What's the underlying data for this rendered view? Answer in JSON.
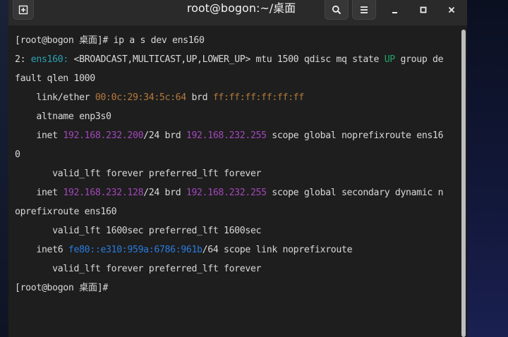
{
  "window": {
    "title": "root@bogon:~/桌面"
  },
  "icons": {
    "new_tab": "new-tab-icon",
    "search": "search-icon",
    "menu": "hamburger-menu-icon",
    "minimize": "minimize-icon",
    "maximize": "maximize-icon",
    "close": "close-icon"
  },
  "colors": {
    "cyan": "#2aa1b3",
    "green": "#26a269",
    "orange": "#b5793c",
    "purple": "#a347ba",
    "blue": "#2a7bde",
    "foreground": "#d8d8d8",
    "background": "#1e1e1e"
  },
  "terminal": {
    "lines": [
      [
        {
          "t": "[root@bogon 桌面]# ip a s dev ens160"
        }
      ],
      [
        {
          "t": "2: "
        },
        {
          "t": "ens160:",
          "c": "cyan"
        },
        {
          "t": " <BROADCAST,MULTICAST,UP,LOWER_UP> mtu 1500 qdisc mq state "
        },
        {
          "t": "UP",
          "c": "green"
        },
        {
          "t": " group de"
        }
      ],
      [
        {
          "t": "fault qlen 1000"
        }
      ],
      [
        {
          "t": "    link/ether "
        },
        {
          "t": "00:0c:29:34:5c:64",
          "c": "orange"
        },
        {
          "t": " brd "
        },
        {
          "t": "ff:ff:ff:ff:ff:ff",
          "c": "orange"
        }
      ],
      [
        {
          "t": "    altname enp3s0"
        }
      ],
      [
        {
          "t": "    inet "
        },
        {
          "t": "192.168.232.200",
          "c": "purple"
        },
        {
          "t": "/24 brd "
        },
        {
          "t": "192.168.232.255",
          "c": "purple"
        },
        {
          "t": " scope global noprefixroute ens16"
        }
      ],
      [
        {
          "t": "0"
        }
      ],
      [
        {
          "t": "       valid_lft forever preferred_lft forever"
        }
      ],
      [
        {
          "t": "    inet "
        },
        {
          "t": "192.168.232.128",
          "c": "purple"
        },
        {
          "t": "/24 brd "
        },
        {
          "t": "192.168.232.255",
          "c": "purple"
        },
        {
          "t": " scope global secondary dynamic n"
        }
      ],
      [
        {
          "t": "oprefixroute ens160"
        }
      ],
      [
        {
          "t": "       valid_lft 1600sec preferred_lft 1600sec"
        }
      ],
      [
        {
          "t": "    inet6 "
        },
        {
          "t": "fe80::e310:959a:6786:961b",
          "c": "blue"
        },
        {
          "t": "/64 scope link noprefixroute"
        }
      ],
      [
        {
          "t": "       valid_lft forever preferred_lft forever"
        }
      ],
      [
        {
          "t": "[root@bogon 桌面]#"
        }
      ]
    ]
  }
}
